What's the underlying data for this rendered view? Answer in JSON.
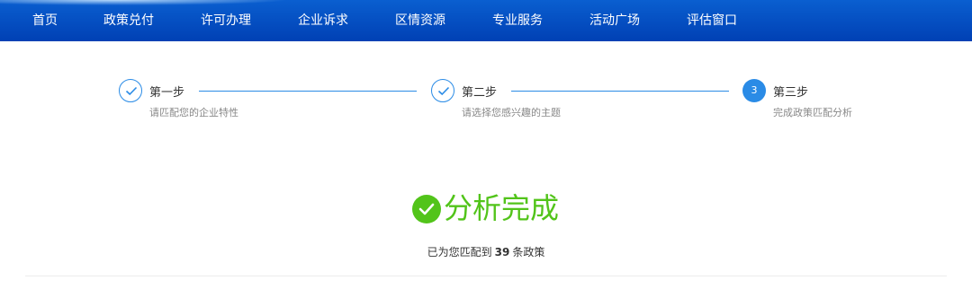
{
  "nav": {
    "items": [
      {
        "label": "首页"
      },
      {
        "label": "政策兑付"
      },
      {
        "label": "许可办理"
      },
      {
        "label": "企业诉求"
      },
      {
        "label": "区情资源"
      },
      {
        "label": "专业服务"
      },
      {
        "label": "活动广场"
      },
      {
        "label": "评估窗口"
      }
    ]
  },
  "steps": [
    {
      "title": "第一步",
      "desc": "请匹配您的企业特性",
      "status": "done"
    },
    {
      "title": "第二步",
      "desc": "请选择您感兴趣的主题",
      "status": "done"
    },
    {
      "number": "3",
      "title": "第三步",
      "desc": "完成政策匹配分析",
      "status": "active"
    }
  ],
  "result": {
    "title": "分析完成",
    "summary_prefix": "已为您匹配到",
    "count": "39",
    "summary_suffix": "条政策"
  },
  "colors": {
    "nav_bg": "#0050c8",
    "step_accent": "#2a8be6",
    "success": "#52c41a"
  }
}
